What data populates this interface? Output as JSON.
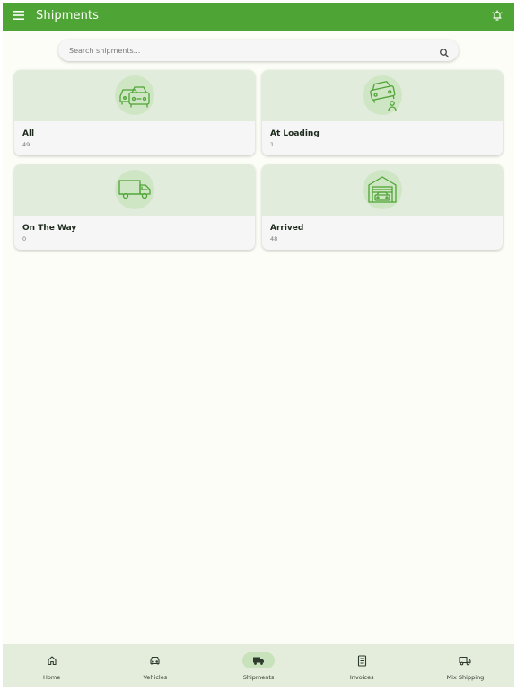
{
  "appbar": {
    "title": "Shipments",
    "menu_icon": "menu-icon",
    "bell_icon": "notification-bell-icon",
    "color": "#4ea434"
  },
  "search": {
    "placeholder": "Search shipments...",
    "value": "",
    "icon": "search-icon"
  },
  "cards": [
    {
      "label": "All",
      "count": "49",
      "icon": "cars-icon"
    },
    {
      "label": "At Loading",
      "count": "1",
      "icon": "car-loading-icon"
    },
    {
      "label": "On The Way",
      "count": "0",
      "icon": "truck-icon"
    },
    {
      "label": "Arrived",
      "count": "48",
      "icon": "garage-car-icon"
    }
  ],
  "bottom_nav": {
    "active": "Shipments",
    "items": [
      {
        "label": "Home",
        "icon": "home-icon"
      },
      {
        "label": "Vehicles",
        "icon": "car-icon"
      },
      {
        "label": "Shipments",
        "icon": "truck-icon"
      },
      {
        "label": "Invoices",
        "icon": "invoice-icon"
      },
      {
        "label": "Mix Shipping",
        "icon": "truck-outline-icon"
      }
    ]
  }
}
